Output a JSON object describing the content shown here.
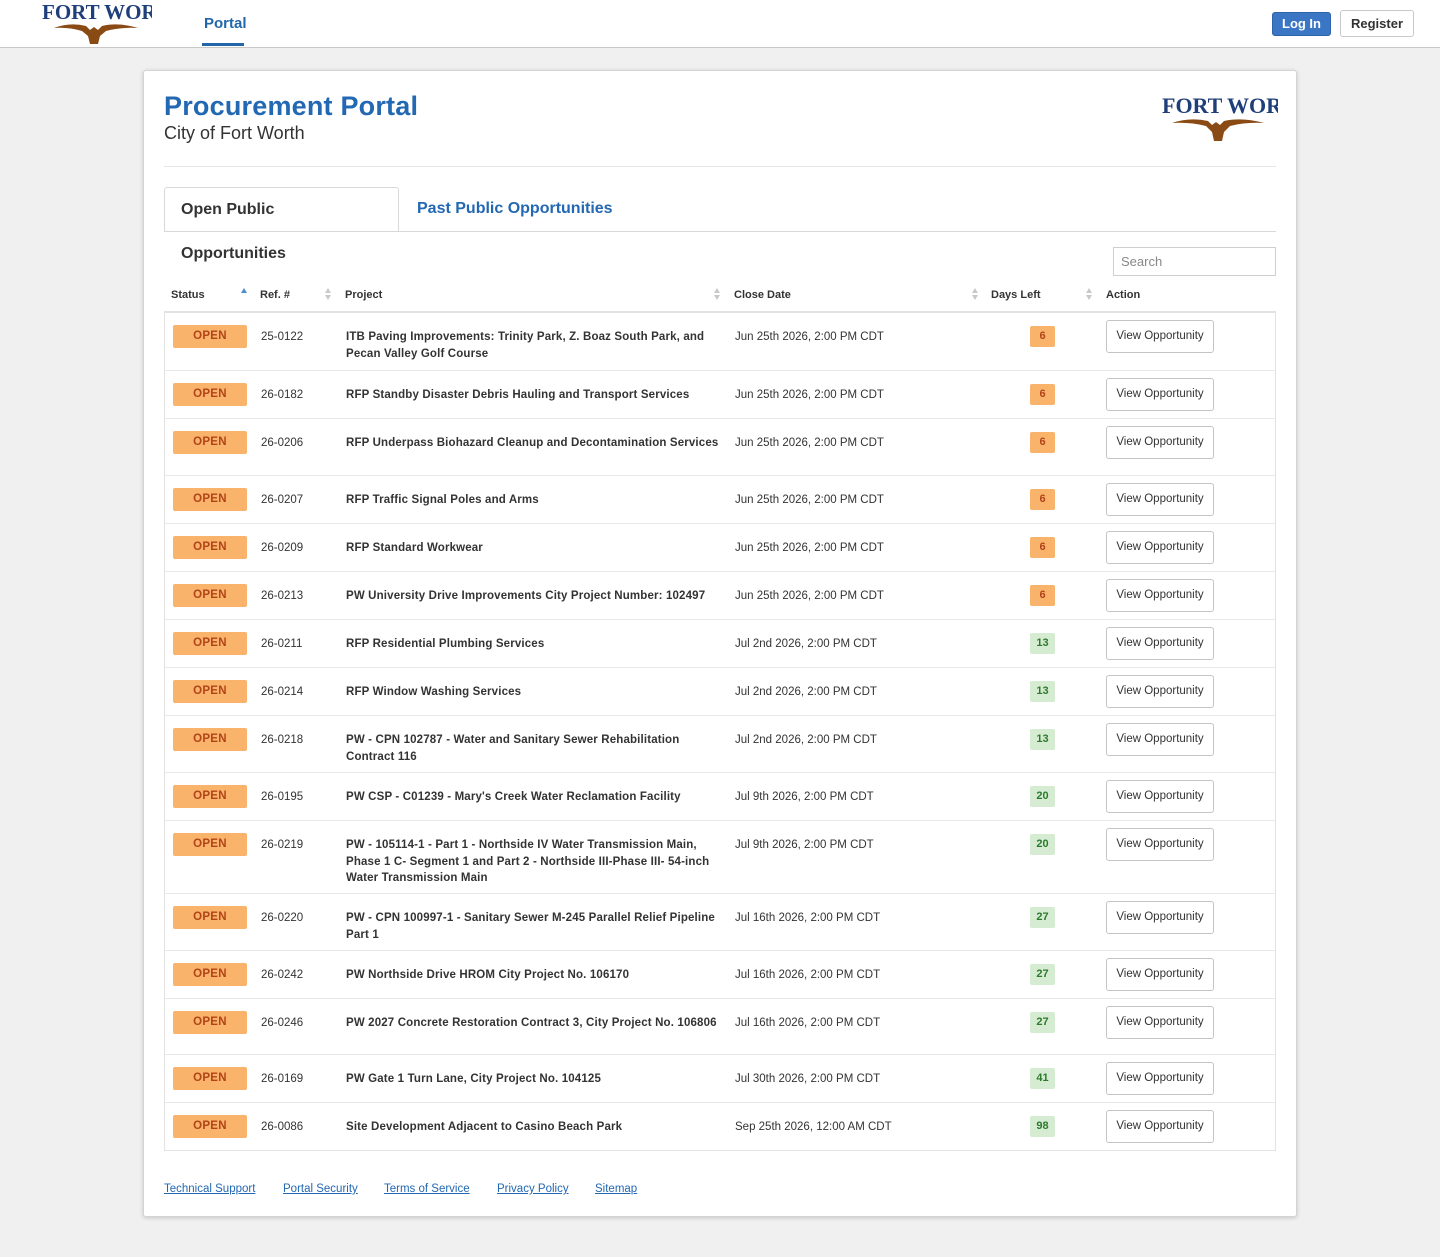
{
  "nav": {
    "logo_text": "FORT WORTH.",
    "portal_tab": "Portal",
    "login_label": "Log In",
    "register_label": "Register"
  },
  "header": {
    "title": "Procurement Portal",
    "subtitle": "City of Fort Worth",
    "logo_text": "FORT WORTH."
  },
  "tabs": [
    {
      "label": "Open Public Opportunities",
      "active": true
    },
    {
      "label": "Past Public Opportunities",
      "active": false
    }
  ],
  "search": {
    "placeholder": "Search",
    "value": ""
  },
  "table": {
    "columns": [
      "Status",
      "Ref. #",
      "Project",
      "Close Date",
      "Days Left",
      "Action"
    ],
    "rows": [
      {
        "status": "OPEN",
        "ref": "25-0122",
        "project": "ITB Paving Improvements: Trinity Park, Z. Boaz South Park, and Pecan Valley Golf Course",
        "close": "Jun 25th 2026, 2:00 PM CDT",
        "days": "6",
        "days_color": "orange",
        "action": "View Opportunity"
      },
      {
        "status": "OPEN",
        "ref": "26-0182",
        "project": "RFP Standby Disaster Debris Hauling and Transport Services",
        "close": "Jun 25th 2026, 2:00 PM CDT",
        "days": "6",
        "days_color": "orange",
        "action": "View Opportunity"
      },
      {
        "status": "OPEN",
        "ref": "26-0206",
        "project": "RFP Underpass Biohazard Cleanup and Decontamination Services",
        "close": "Jun 25th 2026, 2:00 PM CDT",
        "days": "6",
        "days_color": "orange",
        "action": "View Opportunity"
      },
      {
        "status": "OPEN",
        "ref": "26-0207",
        "project": "RFP Traffic Signal Poles and Arms",
        "close": "Jun 25th 2026, 2:00 PM CDT",
        "days": "6",
        "days_color": "orange",
        "action": "View Opportunity"
      },
      {
        "status": "OPEN",
        "ref": "26-0209",
        "project": "RFP Standard Workwear",
        "close": "Jun 25th 2026, 2:00 PM CDT",
        "days": "6",
        "days_color": "orange",
        "action": "View Opportunity"
      },
      {
        "status": "OPEN",
        "ref": "26-0213",
        "project": "PW University Drive Improvements City Project Number: 102497",
        "close": "Jun 25th 2026, 2:00 PM CDT",
        "days": "6",
        "days_color": "orange",
        "action": "View Opportunity"
      },
      {
        "status": "OPEN",
        "ref": "26-0211",
        "project": "RFP Residential Plumbing Services",
        "close": "Jul 2nd 2026, 2:00 PM CDT",
        "days": "13",
        "days_color": "green",
        "action": "View Opportunity"
      },
      {
        "status": "OPEN",
        "ref": "26-0214",
        "project": "RFP Window Washing Services",
        "close": "Jul 2nd 2026, 2:00 PM CDT",
        "days": "13",
        "days_color": "green",
        "action": "View Opportunity"
      },
      {
        "status": "OPEN",
        "ref": "26-0218",
        "project": "PW - CPN 102787 - Water and Sanitary Sewer Rehabilitation Contract 116",
        "close": "Jul 2nd 2026, 2:00 PM CDT",
        "days": "13",
        "days_color": "green",
        "action": "View Opportunity"
      },
      {
        "status": "OPEN",
        "ref": "26-0195",
        "project": "PW CSP - C01239 - Mary's Creek Water Reclamation Facility",
        "close": "Jul 9th 2026, 2:00 PM CDT",
        "days": "20",
        "days_color": "green",
        "action": "View Opportunity"
      },
      {
        "status": "OPEN",
        "ref": "26-0219",
        "project": "PW - 105114-1 - Part 1 - Northside IV Water Transmission Main, Phase 1 C- Segment 1 and Part 2 - Northside III-Phase III- 54-inch Water Transmission Main",
        "close": "Jul 9th 2026, 2:00 PM CDT",
        "days": "20",
        "days_color": "green",
        "action": "View Opportunity"
      },
      {
        "status": "OPEN",
        "ref": "26-0220",
        "project": "PW - CPN 100997-1 - Sanitary Sewer M-245 Parallel Relief Pipeline Part 1",
        "close": "Jul 16th 2026, 2:00 PM CDT",
        "days": "27",
        "days_color": "green",
        "action": "View Opportunity"
      },
      {
        "status": "OPEN",
        "ref": "26-0242",
        "project": "PW Northside Drive HROM City Project No. 106170",
        "close": "Jul 16th 2026, 2:00 PM CDT",
        "days": "27",
        "days_color": "green",
        "action": "View Opportunity"
      },
      {
        "status": "OPEN",
        "ref": "26-0246",
        "project": "PW 2027 Concrete Restoration Contract 3, City Project No. 106806",
        "close": "Jul 16th 2026, 2:00 PM CDT",
        "days": "27",
        "days_color": "green",
        "action": "View Opportunity"
      },
      {
        "status": "OPEN",
        "ref": "26-0169",
        "project": "PW Gate 1 Turn Lane, City Project No. 104125",
        "close": "Jul 30th 2026, 2:00 PM CDT",
        "days": "41",
        "days_color": "green",
        "action": "View Opportunity"
      },
      {
        "status": "OPEN",
        "ref": "26-0086",
        "project": "Site Development Adjacent to Casino Beach Park",
        "close": "Sep 25th 2026, 12:00 AM CDT",
        "days": "98",
        "days_color": "green",
        "action": "View Opportunity"
      }
    ]
  },
  "footer": {
    "links": [
      "Technical Support",
      "Portal Security",
      "Terms of Service",
      "Privacy Policy",
      "Sitemap"
    ]
  },
  "colors": {
    "brand_blue": "#2368b2",
    "open_badge": "#f9b36b",
    "days_green": "#d6ecd2",
    "login_button": "#3a76c4"
  }
}
